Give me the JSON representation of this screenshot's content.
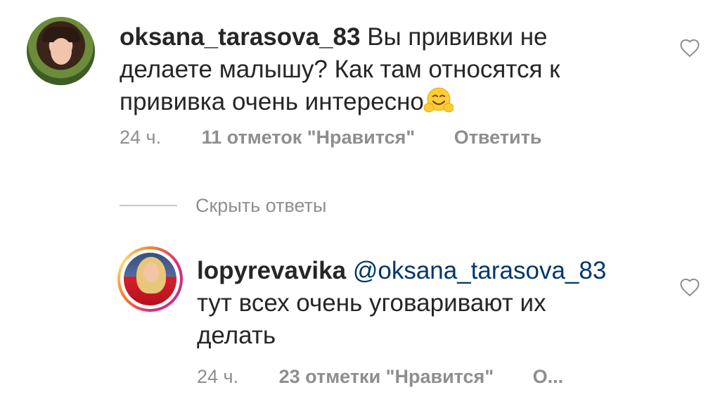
{
  "comments": [
    {
      "username": "oksana_tarasova_83",
      "text_line1": "Вы прививки не",
      "text_line2": "делаете малышу? Как там относятся к",
      "text_line3": "прививка очень интересно",
      "emoji": "hugging-face-emoji",
      "time": "24 ч.",
      "likes": "11 отметок \"Нравится\"",
      "reply": "Ответить",
      "liked": false
    },
    {
      "username": "lopyrevavika",
      "mention": "@oksana_tarasova_83",
      "text_line2": "тут всех очень уговаривают их",
      "text_line3": "делать",
      "time": "24 ч.",
      "likes": "23 отметки \"Нравится\"",
      "reply": "О...",
      "liked": false
    }
  ],
  "hide_replies": "Скрыть ответы",
  "icons": {
    "like": "heart-outline-icon",
    "avatar_story_ring": "instagram-story-ring"
  },
  "colors": {
    "text": "#262626",
    "meta": "#8e8e8e",
    "mention": "#00376b",
    "heart": "#8e8e8e"
  }
}
